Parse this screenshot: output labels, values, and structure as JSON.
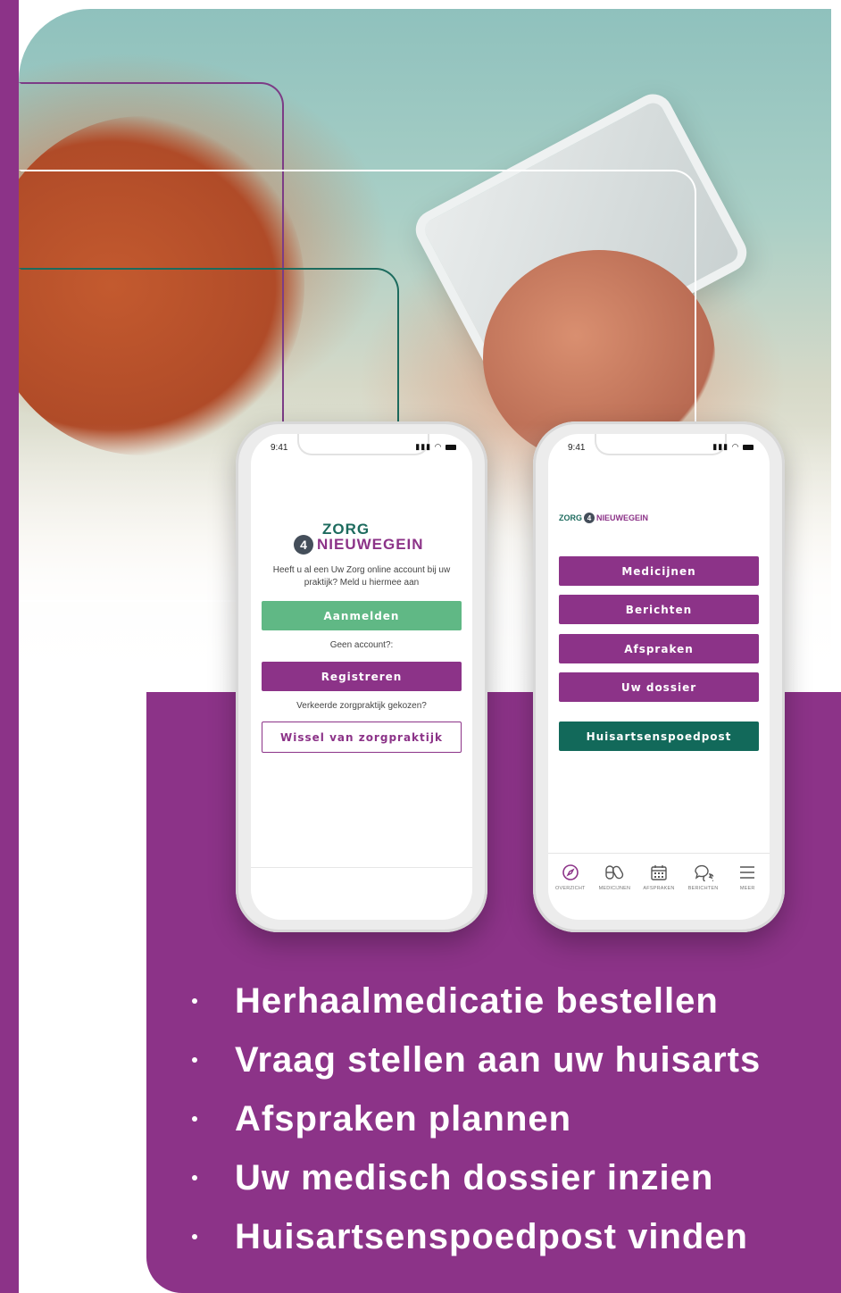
{
  "colors": {
    "purple": "#8c3388",
    "green": "#60b885",
    "dark_green": "#12695a",
    "white": "#ffffff"
  },
  "phone_left": {
    "status_time": "9:41",
    "logo_line1": "ZORG",
    "logo_badge": "4",
    "logo_line2": "NIEUWEGEIN",
    "intro_text": "Heeft u al een Uw Zorg online account bij uw praktijk? Meld u hiermee aan",
    "login_button": "Aanmelden",
    "no_account_text": "Geen account?:",
    "register_button": "Registreren",
    "wrong_practice_text": "Verkeerde zorgpraktijk gekozen?",
    "switch_button": "Wissel van zorgpraktijk"
  },
  "phone_right": {
    "status_time": "9:41",
    "logo_zorg": "ZORG",
    "logo_badge": "4",
    "logo_nieuwegein": "NIEUWEGEIN",
    "menu": {
      "medicines": "Medicijnen",
      "messages": "Berichten",
      "appointments": "Afspraken",
      "dossier": "Uw dossier",
      "emergency": "Huisartsenspoedpost"
    },
    "tabs": {
      "overview": "OVERZICHT",
      "medicines": "MEDICIJNEN",
      "appointments": "AFSPRAKEN",
      "messages": "BERICHTEN",
      "more": "MEER"
    }
  },
  "features": {
    "f1": "Herhaalmedicatie bestellen",
    "f2": "Vraag stellen aan uw huisarts",
    "f3": "Afspraken plannen",
    "f4": "Uw medisch dossier inzien",
    "f5": "Huisartsenspoedpost vinden"
  }
}
